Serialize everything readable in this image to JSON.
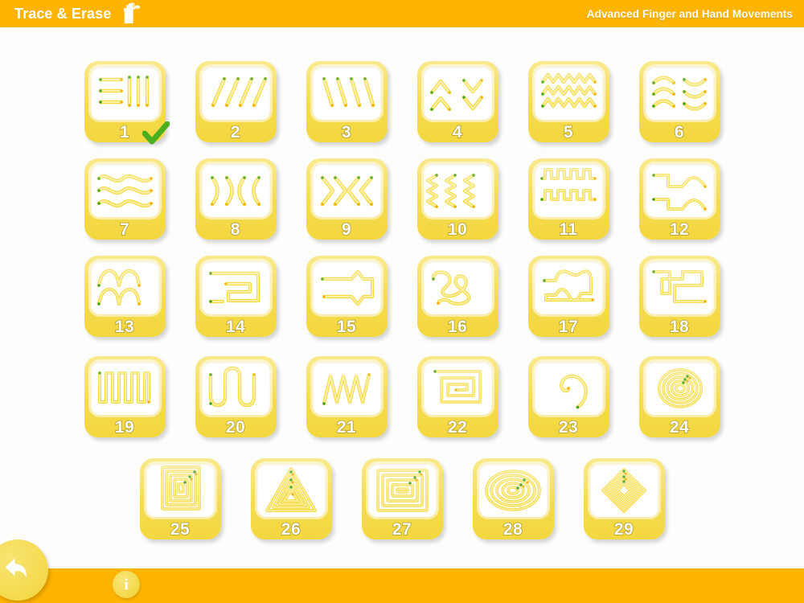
{
  "header": {
    "brand_title": "Trace & Erase",
    "brand_icon": "hand-tracing-icon",
    "subtitle": "Advanced Finger and Hand Movements"
  },
  "colors": {
    "header_bg": "#ffb400",
    "tile_yellow": "#f6dd52",
    "tile_yellow_dark": "#f3d73f",
    "card_white": "#ffffff",
    "number_fill": "#ffffff",
    "number_outline": "#b09b2a",
    "check_green": "#4caf1e",
    "stroke_yellow": "#f5d93c",
    "stroke_yellow_light": "#fdf0a6",
    "start_dot_green": "#3fa019",
    "end_dot_orange": "#f2a900",
    "page_bg": "#fdfdfb"
  },
  "grid": {
    "columns": 6,
    "rows": [
      [
        1,
        2,
        3,
        4,
        5,
        6
      ],
      [
        7,
        8,
        9,
        10,
        11,
        12
      ],
      [
        13,
        14,
        15,
        16,
        17,
        18
      ],
      [
        19,
        20,
        21,
        22,
        23,
        24
      ],
      [
        25,
        26,
        27,
        28,
        29
      ]
    ],
    "tiles": [
      {
        "number": "1",
        "pattern": "horizontal-and-vertical-lines",
        "completed": true
      },
      {
        "number": "2",
        "pattern": "diagonal-lines-right",
        "completed": false
      },
      {
        "number": "3",
        "pattern": "diagonal-lines-left",
        "completed": false
      },
      {
        "number": "4",
        "pattern": "chevrons-up-and-down",
        "completed": false
      },
      {
        "number": "5",
        "pattern": "zigzag-rows",
        "completed": false
      },
      {
        "number": "6",
        "pattern": "arcs-caps-and-cups",
        "completed": false
      },
      {
        "number": "7",
        "pattern": "wavy-lines",
        "completed": false
      },
      {
        "number": "8",
        "pattern": "vertical-arcs",
        "completed": false
      },
      {
        "number": "9",
        "pattern": "angle-brackets",
        "completed": false
      },
      {
        "number": "10",
        "pattern": "vertical-zigzags",
        "completed": false
      },
      {
        "number": "11",
        "pattern": "square-wave-double",
        "completed": false
      },
      {
        "number": "12",
        "pattern": "square-and-arch-mix",
        "completed": false
      },
      {
        "number": "13",
        "pattern": "arch-wave-double",
        "completed": false
      },
      {
        "number": "14",
        "pattern": "angular-spiral-path",
        "completed": false
      },
      {
        "number": "15",
        "pattern": "pointed-path",
        "completed": false
      },
      {
        "number": "16",
        "pattern": "squiggle-loop",
        "completed": false
      },
      {
        "number": "17",
        "pattern": "double-loop-path",
        "completed": false
      },
      {
        "number": "18",
        "pattern": "maze-path",
        "completed": false
      },
      {
        "number": "19",
        "pattern": "square-wave",
        "completed": false
      },
      {
        "number": "20",
        "pattern": "rounded-wave",
        "completed": false
      },
      {
        "number": "21",
        "pattern": "sharp-zigzag",
        "completed": false
      },
      {
        "number": "22",
        "pattern": "square-spiral",
        "completed": false
      },
      {
        "number": "23",
        "pattern": "round-spiral",
        "completed": false
      },
      {
        "number": "24",
        "pattern": "concentric-circles",
        "completed": false
      },
      {
        "number": "25",
        "pattern": "concentric-squares",
        "completed": false
      },
      {
        "number": "26",
        "pattern": "concentric-triangles",
        "completed": false
      },
      {
        "number": "27",
        "pattern": "concentric-rectangles",
        "completed": false
      },
      {
        "number": "28",
        "pattern": "concentric-ellipses",
        "completed": false
      },
      {
        "number": "29",
        "pattern": "concentric-diamonds",
        "completed": false
      }
    ]
  },
  "footer": {
    "back_button_label": "",
    "back_icon": "back-arrow-icon",
    "info_button_label": "i",
    "info_icon": "info-icon"
  }
}
